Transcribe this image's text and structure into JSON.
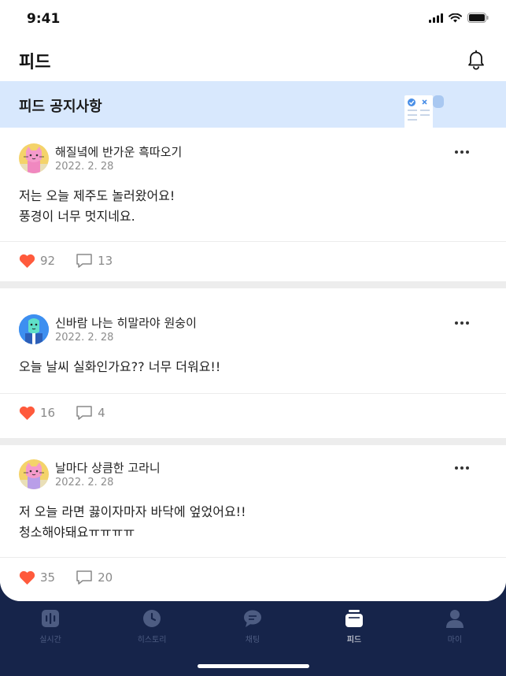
{
  "status_bar": {
    "time": "9:41"
  },
  "header": {
    "title": "피드"
  },
  "notice": {
    "label": "피드 공지사항"
  },
  "posts": [
    {
      "author": "해질녘에 반가운 흑따오기",
      "date": "2022. 2. 28",
      "body": "저는 오늘 제주도 놀러왔어요!\n풍경이 너무 멋지네요.",
      "likes": "92",
      "comments": "13",
      "avatar_color": "#f4d36a"
    },
    {
      "author": "신바람 나는 히말라야 원숭이",
      "date": "2022. 2. 28",
      "body": "오늘 날씨 실화인가요?? 너무 더워요!!",
      "likes": "16",
      "comments": "4",
      "avatar_color": "#3d8ff0"
    },
    {
      "author": "날마다 상큼한 고라니",
      "date": "2022. 2. 28",
      "body": "저 오늘 라면 끓이자마자 바닥에 엎었어요!!\n청소해야돼요ㅠㅠㅠㅠ",
      "likes": "35",
      "comments": "20",
      "avatar_color": "#f4d36a"
    }
  ],
  "tabbar": {
    "items": [
      {
        "label": "실시간",
        "icon": "live-icon"
      },
      {
        "label": "히스토리",
        "icon": "clock-icon"
      },
      {
        "label": "채팅",
        "icon": "chat-icon"
      },
      {
        "label": "피드",
        "icon": "feed-icon",
        "active": true
      },
      {
        "label": "마이",
        "icon": "person-icon"
      }
    ]
  },
  "colors": {
    "accent": "#ff5a3c",
    "notice_bg": "#d8e8fd",
    "tabbar_bg": "#16244a",
    "inactive_tab": "#4d5c82"
  }
}
